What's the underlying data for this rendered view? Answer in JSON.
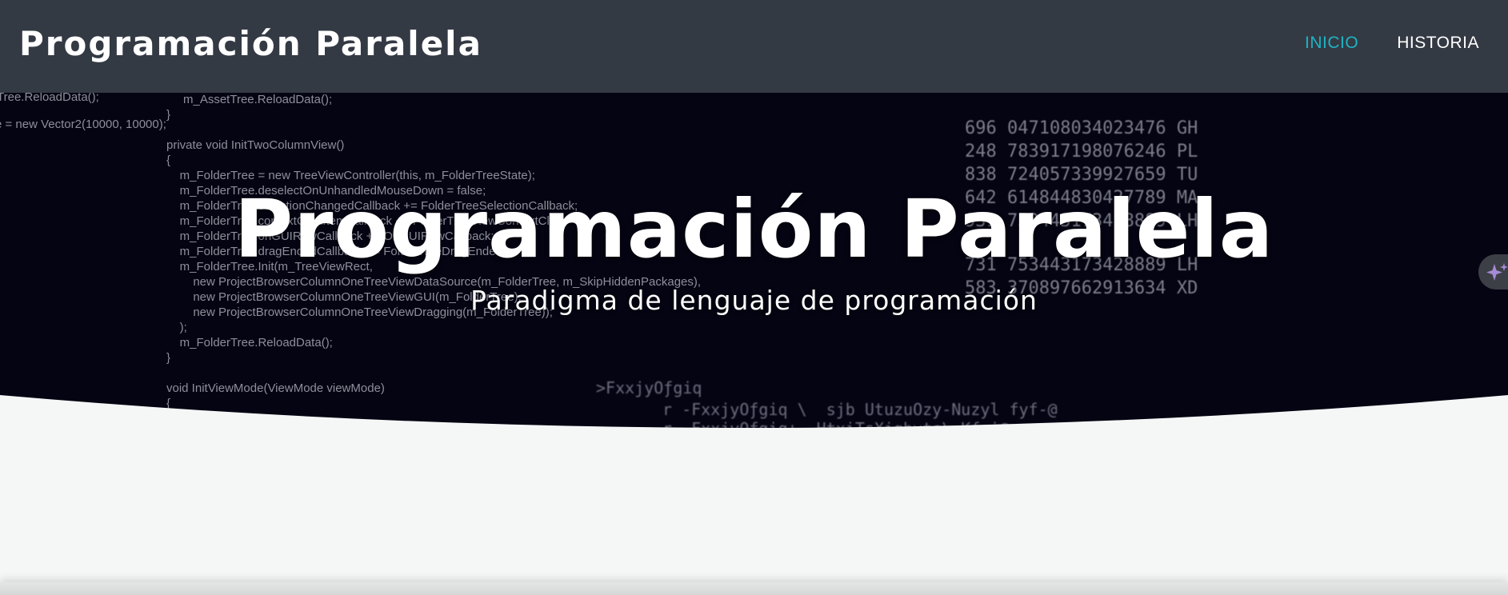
{
  "navbar": {
    "brand": "Programación Paralela",
    "links": [
      {
        "label": "INICIO",
        "active": true
      },
      {
        "label": "HISTORIA",
        "active": false
      }
    ],
    "background_color": "#343a44",
    "active_color": "#1fb3c4"
  },
  "hero": {
    "title": "Programación Paralela",
    "subtitle": "Paradigma de lenguaje de programación",
    "background_color": "#050412",
    "code_lines": [
      "m_AssetTree.ReloadData();",
      "}",
      "private void InitTwoColumnView()",
      "{",
      "    m_FolderTree = new TreeViewController(this, m_FolderTreeState);",
      "    m_FolderTree.deselectOnUnhandledMouseDown = false;",
      "    m_FolderTree.selectionChangedCallback += FolderTreeSelectionCallback;",
      "    m_FolderTree.contextClickItemCallback += FolderTreeViewContextClick;",
      "    m_FolderTree.onGUIRowCallback += OnGUIRowCallback;",
      "    m_FolderTree.dragEndedCallback += FolderTreeDragEnded;",
      "    m_FolderTree.Init(m_TreeViewRect,",
      "        new ProjectBrowserColumnOneTreeViewDataSource(m_FolderTree, m_SkipHiddenPackages),",
      "        new ProjectBrowserColumnOneTreeViewGUI(m_FolderTree),",
      "        new ProjectBrowserColumnOneTreeViewDragging(m_FolderTree));",
      "    );",
      "    m_FolderTree.ReloadData();",
      "}",
      "void InitViewMode(ViewMode viewMode)",
      "{"
    ],
    "left_fragments": [
      "Tree.ReloadData();",
      "e = new Vector2(10000, 10000);"
    ],
    "number_lines": [
      "696 047108034023476 GH",
      "248 783917198076246 PL",
      "838 724057339927659 TU",
      "642 614844830427789 MA",
      "931 753443173428889 LH",
      "731 753443173428889 LH",
      "583 370897662913634 XD"
    ],
    "glyph_lines": [
      ">FxxjyOƒgiq",
      "r -FxxjyOƒgiq \\  sjb UtuzuOzy-Nuzyl fyf-@",
      "r -FxxjyOƒgiq+ -HtxiTsXighvts\\ Kfqi@"
    ]
  },
  "assistant_button": {
    "icon": "sparkle-icon",
    "icon_color": "#a58bd6"
  },
  "page_background": "#f5f7f7"
}
